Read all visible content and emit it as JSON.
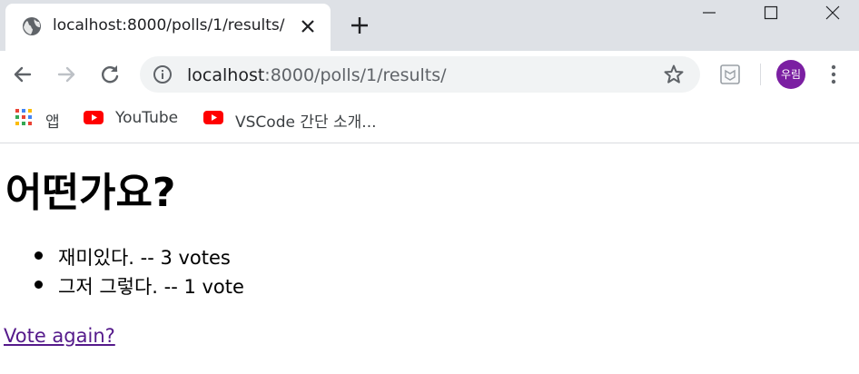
{
  "tab": {
    "title": "localhost:8000/polls/1/results/",
    "favicon": "globe-icon"
  },
  "toolbar": {
    "url_host": "localhost",
    "url_path": ":8000/polls/1/results/",
    "avatar_label": "우림",
    "avatar_color": "#7b1fa2"
  },
  "bookmarks": {
    "items": [
      {
        "label": "앱",
        "icon": "apps-grid-icon"
      },
      {
        "label": "YouTube",
        "icon": "youtube-icon"
      },
      {
        "label": "VSCode 간단 소개...",
        "icon": "youtube-icon"
      }
    ]
  },
  "page": {
    "title": "어떤가요?",
    "results": [
      {
        "text": "재미있다. -- 3 votes"
      },
      {
        "text": "그저 그렇다. -- 1 vote"
      }
    ],
    "vote_again_label": "Vote again?",
    "link_color": "#551a8b"
  }
}
